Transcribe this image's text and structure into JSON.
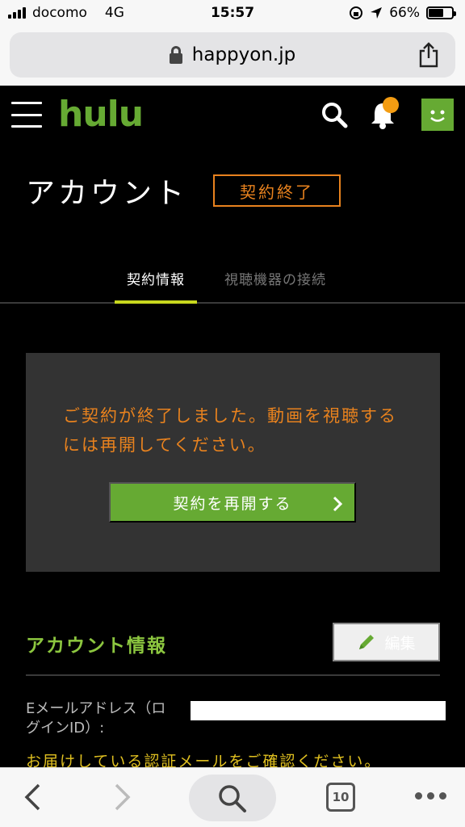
{
  "status_bar": {
    "carrier": "docomo",
    "network": "4G",
    "time": "15:57",
    "battery": "66%",
    "battery_level": 0.66
  },
  "url_bar": {
    "domain": "happyon.jp"
  },
  "header": {
    "logo": "hulu",
    "icons": [
      "menu-icon",
      "search-icon",
      "bell-icon",
      "avatar-icon"
    ],
    "brand_color": "#66aa33",
    "notification_color": "#f39c12"
  },
  "page": {
    "title": "アカウント",
    "end_button": "契約終了"
  },
  "tabs": [
    {
      "label": "契約情報",
      "active": true
    },
    {
      "label": "視聴機器の接続",
      "active": false
    }
  ],
  "notice": {
    "message": "ご契約が終了しました。動画を視聴するには再開してください。",
    "resume_button": "契約を再開する"
  },
  "account_info": {
    "title": "アカウント情報",
    "edit_button": "編集",
    "email_label": "Eメールアドレス（ログインID）:",
    "email_notice": "お届けしている認証メールをご確認ください。"
  },
  "toolbar": {
    "tab_count": "10",
    "icons": [
      "back-icon",
      "forward-icon",
      "search-icon",
      "tabs-icon",
      "more-icon"
    ]
  }
}
